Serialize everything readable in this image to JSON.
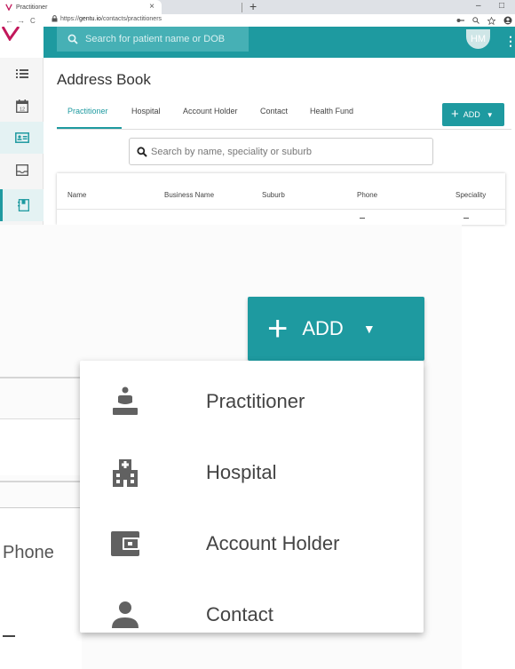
{
  "browser": {
    "tab_title": "Practitioner",
    "tab_close": "×",
    "new_tab": "+",
    "url_scheme": "https://",
    "url_host": "gentu.io",
    "url_path": "/contacts/practitioners",
    "nav_back": "←",
    "nav_forward": "→",
    "reload": "C",
    "minimize": "–",
    "maximize": "□"
  },
  "header": {
    "search_placeholder": "Search for patient name or DOB",
    "avatar_initials": "HM",
    "menu_glyph": "⋮"
  },
  "page": {
    "title": "Address Book",
    "tabs": [
      "Practitioner",
      "Hospital",
      "Account Holder",
      "Contact",
      "Health Fund"
    ],
    "active_tab": "Practitioner",
    "add_label": "ADD",
    "search_placeholder": "Search by name, speciality or suburb",
    "table_headers": [
      "Name",
      "Business Name",
      "Suburb",
      "Phone",
      "Speciality"
    ]
  },
  "zoom": {
    "add_label": "ADD",
    "phone_header_fragment": "Phone",
    "menu_items": [
      {
        "label": "Practitioner",
        "icon": "practitioner-icon"
      },
      {
        "label": "Hospital",
        "icon": "hospital-icon"
      },
      {
        "label": "Account Holder",
        "icon": "wallet-icon"
      },
      {
        "label": "Contact",
        "icon": "person-icon"
      }
    ]
  },
  "colors": {
    "accent": "#1e9aa0",
    "appbar": "#1e9aa0",
    "icon_gray": "#616161"
  }
}
